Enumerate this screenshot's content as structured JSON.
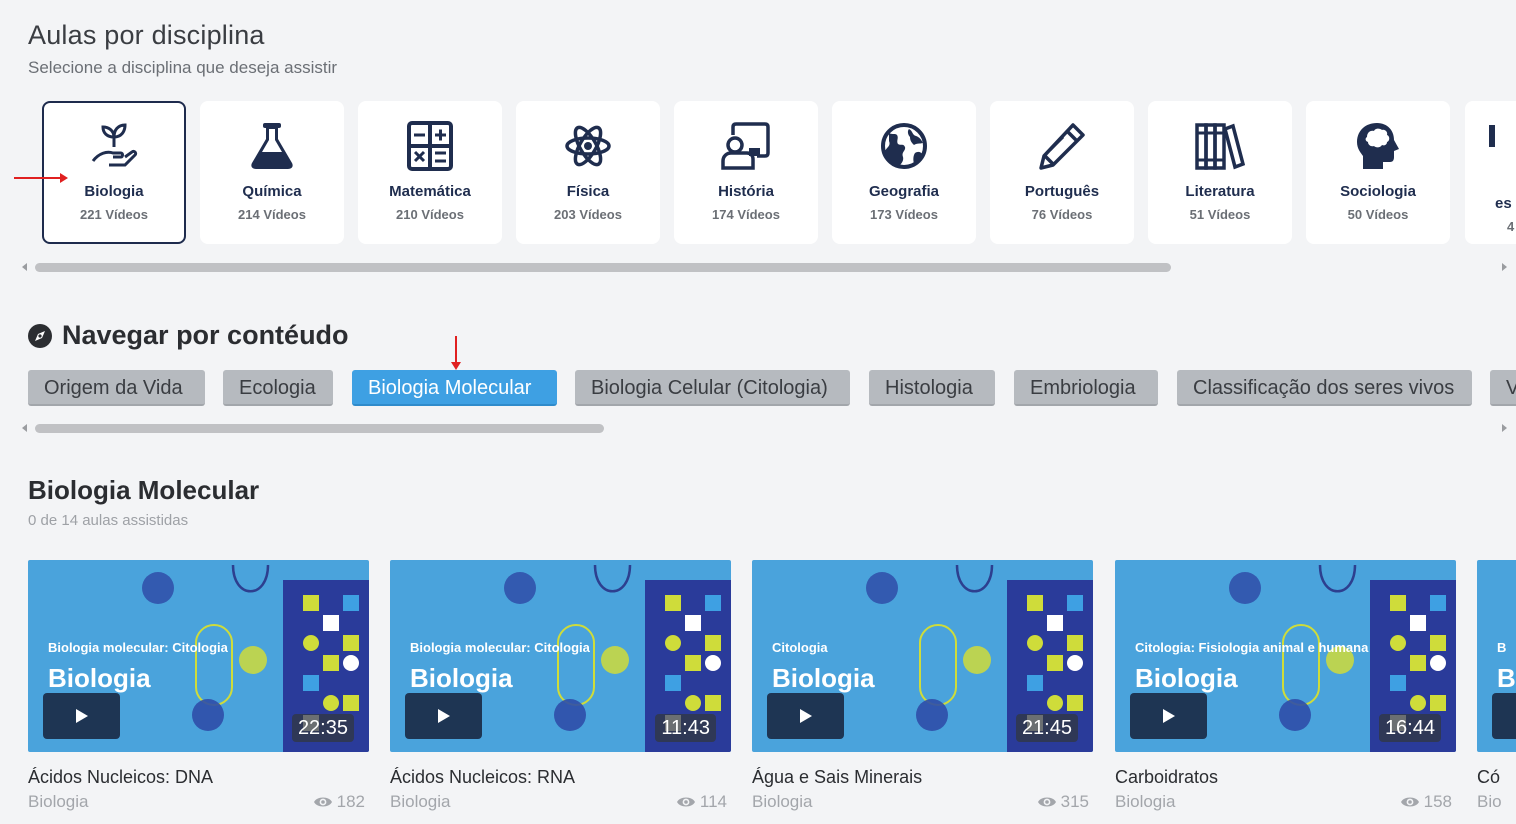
{
  "header": {
    "title": "Aulas por disciplina",
    "subtitle": "Selecione a disciplina que deseja assistir"
  },
  "disciplines": [
    {
      "name": "Biologia",
      "count": "221 Vídeos",
      "icon": "plant-hand-icon",
      "selected": true
    },
    {
      "name": "Química",
      "count": "214 Vídeos",
      "icon": "flask-icon"
    },
    {
      "name": "Matemática",
      "count": "210 Vídeos",
      "icon": "calculator-icon"
    },
    {
      "name": "Física",
      "count": "203 Vídeos",
      "icon": "atom-icon"
    },
    {
      "name": "História",
      "count": "174 Vídeos",
      "icon": "teacher-board-icon"
    },
    {
      "name": "Geografia",
      "count": "173 Vídeos",
      "icon": "globe-icon"
    },
    {
      "name": "Português",
      "count": "76 Vídeos",
      "icon": "pencil-icon"
    },
    {
      "name": "Literatura",
      "count": "51 Vídeos",
      "icon": "books-icon"
    },
    {
      "name": "Sociologia",
      "count": "50 Vídeos",
      "icon": "head-brain-icon"
    },
    {
      "name": "es",
      "count": "4",
      "icon": "partial-icon"
    }
  ],
  "browse": {
    "title": "Navegar por contéudo",
    "icon": "compass-icon",
    "chips": [
      {
        "label": "Origem da Vida"
      },
      {
        "label": "Ecologia"
      },
      {
        "label": "Biologia Molecular",
        "active": true
      },
      {
        "label": "Biologia Celular (Citologia)"
      },
      {
        "label": "Histologia"
      },
      {
        "label": "Embriologia"
      },
      {
        "label": "Classificação dos seres vivos"
      },
      {
        "label": "V"
      }
    ]
  },
  "section": {
    "title": "Biologia Molecular",
    "progress": "0 de 14 aulas assistidas"
  },
  "videos": [
    {
      "thumb_sub": "Biologia molecular: Citologia",
      "thumb_big": "Biologia",
      "duration": "22:35",
      "title": "Ácidos Nucleicos: DNA",
      "subject": "Biologia",
      "views": "182"
    },
    {
      "thumb_sub": "Biologia molecular: Citologia",
      "thumb_big": "Biologia",
      "duration": "11:43",
      "title": "Ácidos Nucleicos: RNA",
      "subject": "Biologia",
      "views": "114"
    },
    {
      "thumb_sub": "Citologia",
      "thumb_big": "Biologia",
      "duration": "21:45",
      "title": "Água e Sais Minerais",
      "subject": "Biologia",
      "views": "315"
    },
    {
      "thumb_sub": "Citologia: Fisiologia animal e humana",
      "thumb_big": "Biologia",
      "duration": "16:44",
      "title": "Carboidratos",
      "subject": "Biologia",
      "views": "158"
    },
    {
      "thumb_sub": "B",
      "thumb_big": "B",
      "duration": "",
      "title": "Có",
      "subject": "Bio",
      "views": ""
    }
  ],
  "colors": {
    "navy": "#1f2d4e",
    "chip_active": "#3ea0e3",
    "chip_default": "#b6babf",
    "thumb_bg": "#4aa3dc",
    "annotation": "#e02020"
  }
}
